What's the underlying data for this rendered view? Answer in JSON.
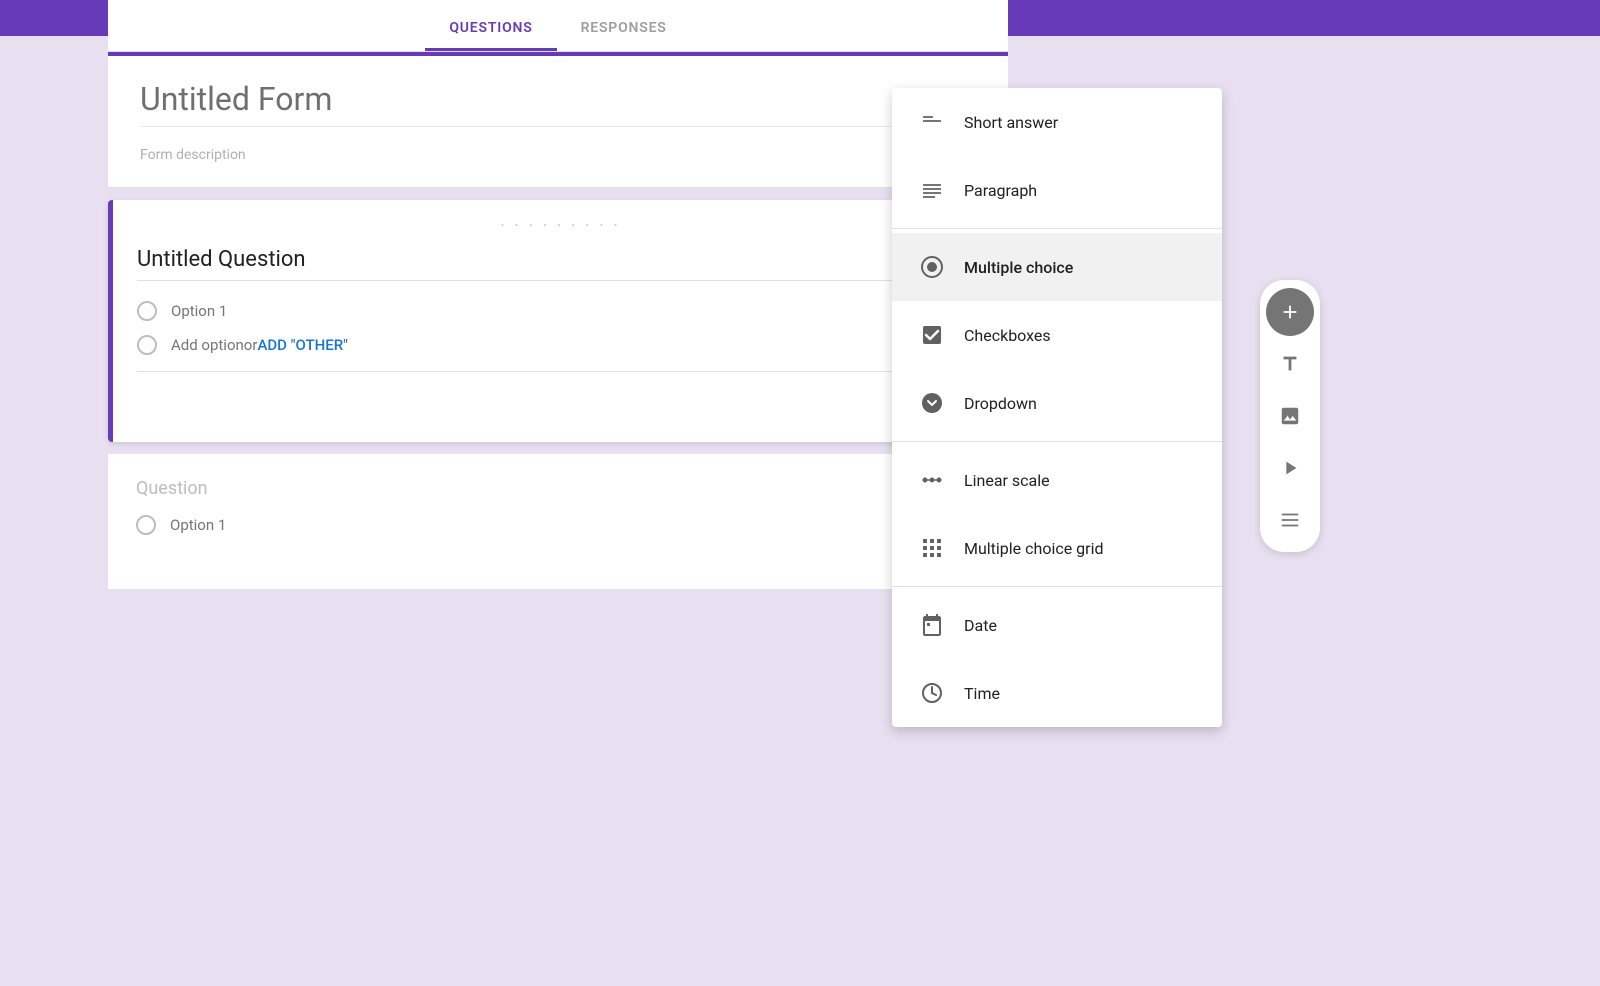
{
  "topbar": {
    "color": "#673ab7"
  },
  "tabs": {
    "questions": "QUESTIONS",
    "responses": "RESPONSES",
    "active": "questions"
  },
  "form": {
    "title": "Untitled Form",
    "description": "Form description"
  },
  "question1": {
    "drag_handle": "· · · · · · · · ·",
    "title": "Untitled Question",
    "option1": "Option 1",
    "add_option": "Add option",
    "add_option_or": " or ",
    "add_other": "ADD \"OTHER\""
  },
  "question2": {
    "title": "Question",
    "option1": "Option 1"
  },
  "dropdown_menu": {
    "items": [
      {
        "id": "short-answer",
        "label": "Short answer",
        "icon": "short-answer-icon"
      },
      {
        "id": "paragraph",
        "label": "Paragraph",
        "icon": "paragraph-icon"
      },
      {
        "id": "multiple-choice",
        "label": "Multiple choice",
        "icon": "multiple-choice-icon",
        "selected": true
      },
      {
        "id": "checkboxes",
        "label": "Checkboxes",
        "icon": "checkboxes-icon"
      },
      {
        "id": "dropdown",
        "label": "Dropdown",
        "icon": "dropdown-icon"
      },
      {
        "id": "linear-scale",
        "label": "Linear scale",
        "icon": "linear-scale-icon"
      },
      {
        "id": "multiple-choice-grid",
        "label": "Multiple choice grid",
        "icon": "multiple-choice-grid-icon"
      },
      {
        "id": "date",
        "label": "Date",
        "icon": "date-icon"
      },
      {
        "id": "time",
        "label": "Time",
        "icon": "time-icon"
      }
    ]
  },
  "sidebar": {
    "add_label": "+",
    "text_label": "Tt",
    "image_label": "🖼",
    "video_label": "▶",
    "section_label": "▬"
  }
}
